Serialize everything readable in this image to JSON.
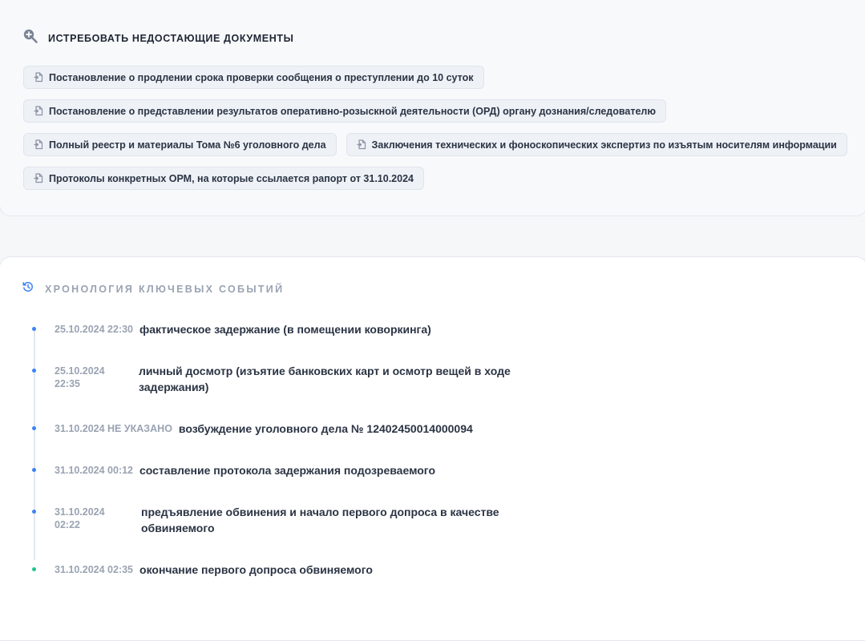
{
  "docs_section": {
    "title": "ИСТРЕБОВАТЬ НЕДОСТАЮЩИЕ ДОКУМЕНТЫ",
    "icon": "search-plus-icon",
    "items": [
      {
        "label": "Постановление о продлении срока проверки сообщения о преступлении до 10 суток",
        "icon": "document-icon"
      },
      {
        "label": "Постановление о представлении результатов оперативно-розыскной деятельности (ОРД) органу дознания/следователю",
        "icon": "document-icon"
      },
      {
        "label": "Полный реестр и материалы Тома №6 уголовного дела",
        "icon": "document-icon"
      },
      {
        "label": "Заключения технических и фоноскопических экспертиз по изъятым носителям информации",
        "icon": "document-icon"
      },
      {
        "label": "Протоколы конкретных ОРМ, на которые ссылается рапорт от 31.10.2024",
        "icon": "document-icon"
      }
    ]
  },
  "timeline_section": {
    "title": "ХРОНОЛОГИЯ КЛЮЧЕВЫХ СОБЫТИЙ",
    "icon": "history-icon",
    "events": [
      {
        "date": "25.10.2024 22:30",
        "text": "фактическое задержание (в помещении коворкинга)",
        "status": "blue"
      },
      {
        "date": "25.10.2024 22:35",
        "text": "личный досмотр (изъятие банковских карт и осмотр вещей в ходе задержания)",
        "status": "blue"
      },
      {
        "date": "31.10.2024 НЕ УКАЗАНО",
        "text": "возбуждение уголовного дела № 12402450014000094",
        "status": "blue"
      },
      {
        "date": "31.10.2024 00:12",
        "text": "составление протокола задержания подозреваемого",
        "status": "blue"
      },
      {
        "date": "31.10.2024 02:22",
        "text": "предъявление обвинения и начало первого допроса в качестве обвиняемого",
        "status": "blue"
      },
      {
        "date": "31.10.2024 02:35",
        "text": "окончание первого допроса обвиняемого",
        "status": "green"
      }
    ]
  },
  "colors": {
    "accent": "#3b82f6",
    "success": "#22c58b",
    "muted_text": "#9aa3b2",
    "body_text": "#2b3444"
  }
}
